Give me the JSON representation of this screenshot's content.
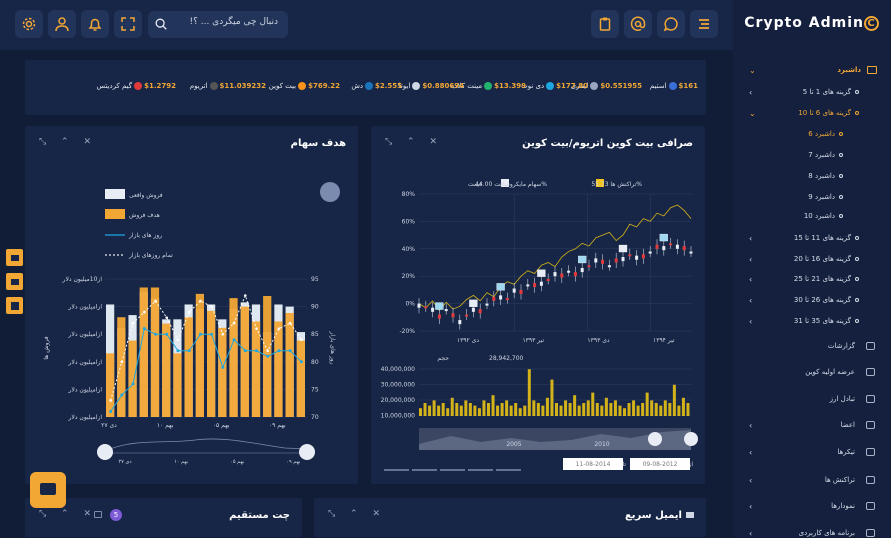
{
  "app": {
    "brand": "Crypto Admin",
    "brand_mark": "C"
  },
  "search": {
    "placeholder": "دنبال چی میگردی ... ؟!"
  },
  "topbar_icons": [
    "settings-icon",
    "user-icon",
    "bell-icon",
    "fullscreen-icon",
    "search-icon",
    "clipboard-icon",
    "at-icon",
    "chat-icon",
    "menu-icon"
  ],
  "sidebar": {
    "dashboard": "داشبرد",
    "items": [
      {
        "label": "گزینه های 1 تا 5"
      },
      {
        "label": "گزینه های 6 تا 10"
      },
      {
        "label": "داشبرد 6"
      },
      {
        "label": "داشبرد 7"
      },
      {
        "label": "داشبرد 8"
      },
      {
        "label": "داشبرد 9"
      },
      {
        "label": "داشبرد 10"
      },
      {
        "label": "گزینه های 11 تا 15"
      },
      {
        "label": "گزینه های 16 تا 20"
      },
      {
        "label": "گزینه های 21 تا 25"
      },
      {
        "label": "گزینه های 26 تا 30"
      },
      {
        "label": "گزینه های 35 تا 31"
      },
      {
        "label": "گزارشات"
      },
      {
        "label": "عرضه اولیه کوین"
      },
      {
        "label": "تبادل ارز"
      },
      {
        "label": "اعضا"
      },
      {
        "label": "تیکرها"
      },
      {
        "label": "تراکنش ها"
      },
      {
        "label": "نمودارها"
      },
      {
        "label": "برنامه های کاربردی"
      }
    ]
  },
  "ticker": [
    {
      "name": "استیم",
      "value": "$161",
      "color": "#3a6fd8"
    },
    {
      "name": "لینتری",
      "value": "$0.551955",
      "color": "#9aa6bf"
    },
    {
      "name": "دی نوت",
      "value": "$177.80",
      "color": "#1ea7e1"
    },
    {
      "name": "مینت کلاب",
      "value": "$13.399",
      "color": "#23b26d"
    },
    {
      "name": "ایوتا",
      "value": "$0.880694",
      "color": "#cfd6e4"
    },
    {
      "name": "دش",
      "value": "$2.555",
      "color": "#1c75bc"
    },
    {
      "name": "بیت کوین",
      "value": "$769.22",
      "color": "#f7931a"
    },
    {
      "name": "اتریوم",
      "value": "$11.039232",
      "color": "#555"
    },
    {
      "name": "گیم کردیتس",
      "value": "$1.2792",
      "color": "#e23a3a"
    }
  ],
  "panels": {
    "exchange": {
      "title": "صرافی بیت کوین اتریوم/بیت کوین",
      "controls": "⤡ ⌃ ✕"
    },
    "target": {
      "title": "هدف سهام",
      "controls": "⤡ ⌃ ✕"
    },
    "email": {
      "title": "ایمیل سریع",
      "controls": "⤡ ⌃ ✕"
    },
    "chat": {
      "title": "چت مستقیم",
      "badge": "5",
      "controls": "⤡ ⌃ ✕"
    }
  },
  "chart_data": [
    {
      "type": "line",
      "title": "",
      "legend": [
        "تراکنش ها 55.73%",
        "سهام مایکروسافت 44.00%",
        "قیمت"
      ],
      "y_ticks": [
        "80%",
        "60%",
        "40%",
        "20%",
        "0%",
        "-20%"
      ],
      "ylim": [
        -20,
        80
      ],
      "x_ticks": [
        "دی ۱۳۹۲",
        "تیر ۱۳۹۳",
        "دی ۱۳۹۳",
        "تیر ۱۳۹۴"
      ],
      "volume_label": "حجم",
      "volume_value": "28,942,700",
      "volume_ticks": [
        "40,000,000",
        "30,000,000",
        "20,000,000",
        "10,000,000"
      ],
      "navigator_ticks": [
        "2005",
        "2010"
      ],
      "range": {
        "from_label": "از",
        "from": "09-08-2012",
        "to_label": "تا",
        "to": "11-08-2014"
      },
      "series": [
        {
          "name": "تراکنش ها",
          "values": [
            0,
            -3,
            2,
            -5,
            1,
            -4,
            -2,
            3,
            6,
            2,
            8,
            5,
            12,
            16,
            14,
            20,
            24,
            22,
            28,
            30,
            27,
            34,
            38,
            40,
            44,
            42,
            48,
            50,
            52,
            46,
            50,
            58,
            56,
            62,
            60,
            66,
            64,
            70,
            72,
            68,
            62
          ]
        },
        {
          "name": "سهام مایکروسافت",
          "values": [
            0,
            -2,
            -6,
            -8,
            -4,
            -10,
            -12,
            -8,
            -6,
            -4,
            0,
            2,
            6,
            4,
            8,
            10,
            14,
            12,
            16,
            18,
            20,
            22,
            24,
            20,
            26,
            28,
            30,
            32,
            28,
            30,
            34,
            36,
            32,
            36,
            38,
            40,
            42,
            44,
            40,
            42,
            38
          ]
        }
      ]
    },
    {
      "type": "bar",
      "title": "",
      "legend": [
        "فروش واقعی",
        "هدف فروش",
        "روز های بازار",
        "تمام روزهای بازار"
      ],
      "categories": [
        "1",
        "2",
        "3",
        "4",
        "5",
        "6",
        "7",
        "8",
        "9",
        "10",
        "11",
        "12",
        "13",
        "14",
        "15",
        "16",
        "17",
        "18"
      ],
      "series": [
        {
          "name": "فروش واقعی",
          "values": [
            5.3,
            4.2,
            4.8,
            5.9,
            5.6,
            4.6,
            4.6,
            5.3,
            5.1,
            5.3,
            4.6,
            5.1,
            5.4,
            5.3,
            4.0,
            5.3,
            5.2,
            4.0
          ]
        },
        {
          "name": "هدف فروش",
          "values": [
            3.0,
            4.7,
            3.6,
            6.1,
            6.1,
            4.4,
            3.0,
            4.7,
            5.8,
            5.0,
            4.2,
            5.6,
            5.2,
            4.5,
            5.7,
            4.5,
            4.9,
            3.6
          ]
        },
        {
          "name": "روز های بازار",
          "values": [
            71,
            74,
            76,
            86,
            85,
            85,
            82,
            82,
            85,
            85,
            79,
            84,
            82,
            82,
            81,
            82,
            82,
            80
          ]
        },
        {
          "name": "تمام روزهای بازار",
          "values": [
            73,
            80,
            87,
            89,
            91,
            88,
            84,
            89,
            91,
            90,
            85,
            87,
            92,
            86,
            82,
            86,
            87,
            84
          ]
        }
      ],
      "y_left_labels": [
        "ازامیلیون دلار",
        "ازامیلیون دلار",
        "ازامیلیون دلار",
        "ازامیلیون دلار",
        "ازامیلیون دلار",
        "از10میلیون دلار"
      ],
      "y_left_title": "فروش ها",
      "y_right_ticks": [
        "95",
        "90",
        "85",
        "80",
        "75",
        "70"
      ],
      "y_right_title": "روز های بازار",
      "x_ticks": [
        "دی ۲۷",
        "بهم ۱۰",
        "بهم ۰۵",
        "بهم ۰۹"
      ],
      "ylim_right": [
        70,
        95
      ]
    }
  ]
}
